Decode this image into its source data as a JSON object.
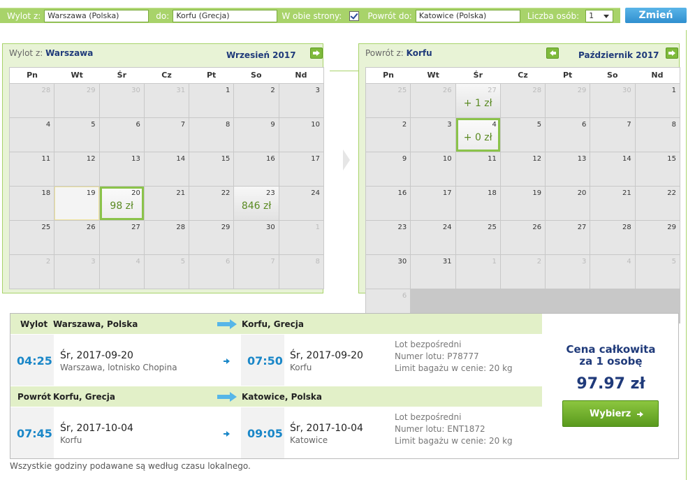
{
  "search": {
    "from_label": "Wylot z:",
    "from_value": "Warszawa (Polska)",
    "to_label": "do:",
    "to_value": "Korfu (Grecja)",
    "roundtrip_label": "W obie strony:",
    "return_label": "Powrót do:",
    "return_value": "Katowice (Polska)",
    "persons_label": "Liczba osób:",
    "persons_value": "1",
    "submit_label": "Zmień"
  },
  "weekdays": [
    "Pn",
    "Wt",
    "Śr",
    "Cz",
    "Pt",
    "So",
    "Nd"
  ],
  "outbound_calendar": {
    "title_prefix": "Wylot z:",
    "title_city": "Warszawa",
    "month": "Wrzesień 2017",
    "days": [
      {
        "n": "28",
        "o": true
      },
      {
        "n": "29",
        "o": true
      },
      {
        "n": "30",
        "o": true
      },
      {
        "n": "31",
        "o": true
      },
      {
        "n": "1"
      },
      {
        "n": "2"
      },
      {
        "n": "3"
      },
      {
        "n": "4"
      },
      {
        "n": "5"
      },
      {
        "n": "6"
      },
      {
        "n": "7"
      },
      {
        "n": "8"
      },
      {
        "n": "9"
      },
      {
        "n": "10"
      },
      {
        "n": "11"
      },
      {
        "n": "12"
      },
      {
        "n": "13"
      },
      {
        "n": "14"
      },
      {
        "n": "15"
      },
      {
        "n": "16"
      },
      {
        "n": "17"
      },
      {
        "n": "18"
      },
      {
        "n": "19",
        "t": true
      },
      {
        "n": "20",
        "p": "98 zł",
        "s": true
      },
      {
        "n": "21"
      },
      {
        "n": "22"
      },
      {
        "n": "23",
        "p": "846 zł"
      },
      {
        "n": "24"
      },
      {
        "n": "25"
      },
      {
        "n": "26"
      },
      {
        "n": "27"
      },
      {
        "n": "28"
      },
      {
        "n": "29"
      },
      {
        "n": "30"
      },
      {
        "n": "1",
        "o": true
      },
      {
        "n": "2",
        "o": true
      },
      {
        "n": "3",
        "o": true
      },
      {
        "n": "4",
        "o": true
      },
      {
        "n": "5",
        "o": true
      },
      {
        "n": "6",
        "o": true
      },
      {
        "n": "7",
        "o": true
      },
      {
        "n": "8",
        "o": true
      }
    ]
  },
  "return_calendar": {
    "title_prefix": "Powrót z:",
    "title_city": "Korfu",
    "month": "Październik 2017",
    "days": [
      {
        "n": "25",
        "o": true
      },
      {
        "n": "26",
        "o": true
      },
      {
        "n": "27",
        "o": true,
        "p": "+ 1 zł"
      },
      {
        "n": "28",
        "o": true
      },
      {
        "n": "29",
        "o": true
      },
      {
        "n": "30",
        "o": true
      },
      {
        "n": "1"
      },
      {
        "n": "2"
      },
      {
        "n": "3"
      },
      {
        "n": "4",
        "p": "+ 0 zł",
        "s": true
      },
      {
        "n": "5"
      },
      {
        "n": "6"
      },
      {
        "n": "7"
      },
      {
        "n": "8"
      },
      {
        "n": "9"
      },
      {
        "n": "10"
      },
      {
        "n": "11"
      },
      {
        "n": "12"
      },
      {
        "n": "13"
      },
      {
        "n": "14"
      },
      {
        "n": "15"
      },
      {
        "n": "16"
      },
      {
        "n": "17"
      },
      {
        "n": "18"
      },
      {
        "n": "19"
      },
      {
        "n": "20"
      },
      {
        "n": "21"
      },
      {
        "n": "22"
      },
      {
        "n": "23"
      },
      {
        "n": "24"
      },
      {
        "n": "25"
      },
      {
        "n": "26"
      },
      {
        "n": "27"
      },
      {
        "n": "28"
      },
      {
        "n": "29"
      },
      {
        "n": "30"
      },
      {
        "n": "31"
      },
      {
        "n": "1",
        "o": true
      },
      {
        "n": "2",
        "o": true
      },
      {
        "n": "3",
        "o": true
      },
      {
        "n": "4",
        "o": true
      },
      {
        "n": "5",
        "o": true
      },
      {
        "n": "6",
        "o": true
      }
    ]
  },
  "outbound": {
    "label": "Wylot",
    "from_city": "Warszawa, Polska",
    "to_city": "Korfu, Grecja",
    "dep_time": "04:25",
    "dep_date": "Śr, 2017-09-20",
    "dep_place": "Warszawa, lotnisko Chopina",
    "arr_time": "07:50",
    "arr_date": "Śr, 2017-09-20",
    "arr_place": "Korfu",
    "info_type": "Lot bezpośredni",
    "info_flight": "Numer lotu: P78777",
    "info_baggage": "Limit bagażu w cenie: 20 kg"
  },
  "inbound": {
    "label": "Powrót",
    "from_city": "Korfu, Grecja",
    "to_city": "Katowice, Polska",
    "dep_time": "07:45",
    "dep_date": "Śr, 2017-10-04",
    "dep_place": "Korfu",
    "arr_time": "09:05",
    "arr_date": "Śr, 2017-10-04",
    "arr_place": "Katowice",
    "info_type": "Lot bezpośredni",
    "info_flight": "Numer lotu: ENT1872",
    "info_baggage": "Limit bagażu w cenie: 20 kg"
  },
  "price": {
    "label_line1": "Cena całkowita",
    "label_line2": "za 1 osobę",
    "amount": "97.97 zł",
    "select_label": "Wybierz"
  },
  "footnote": "Wszystkie godziny podawane są według czasu lokalnego.",
  "colors": {
    "accent_green": "#a8d36a",
    "price_blue": "#1a87c8",
    "title_navy": "#1f3a7a"
  }
}
